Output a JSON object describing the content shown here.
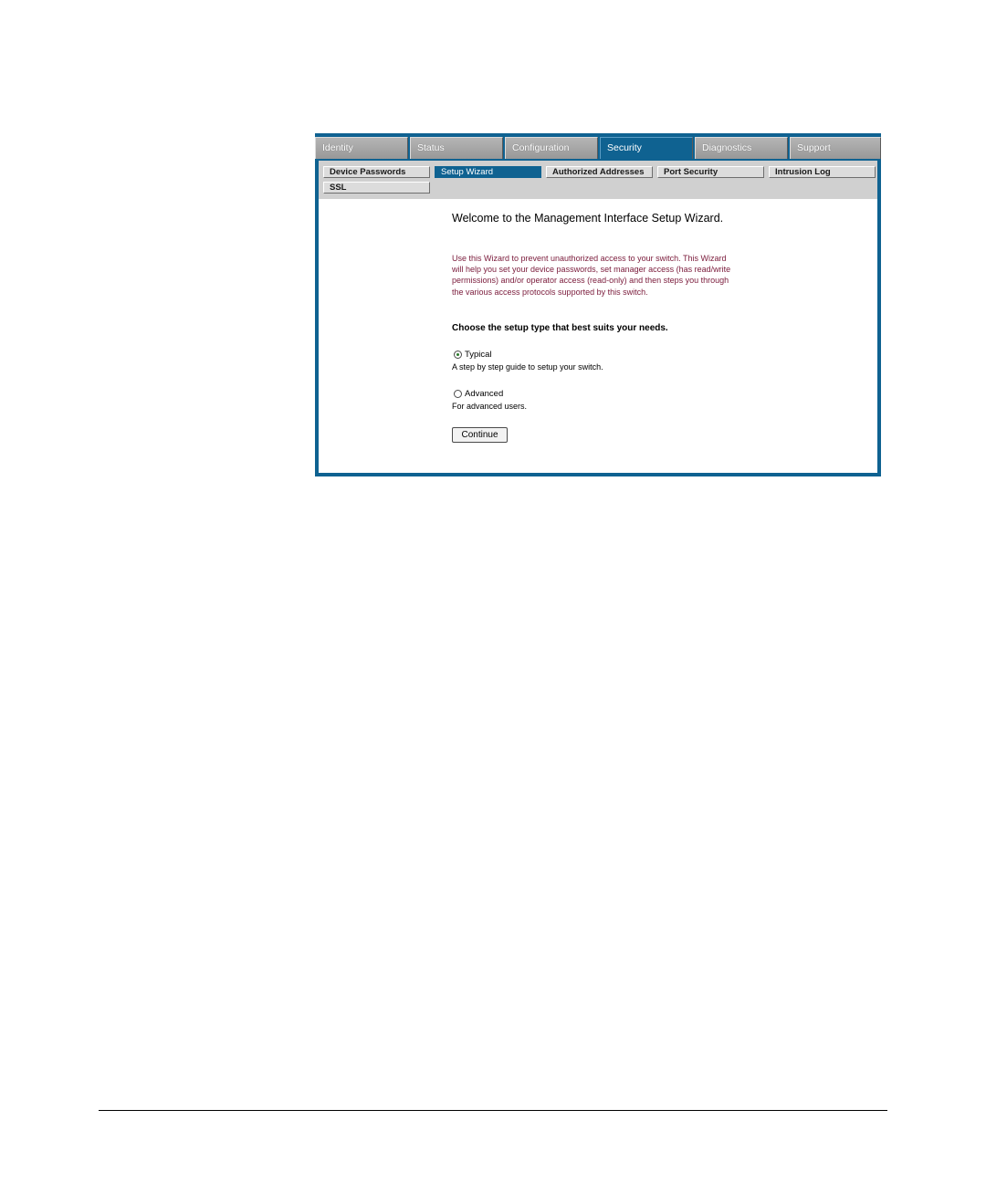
{
  "main_tabs": [
    {
      "label": "Identity",
      "active": false
    },
    {
      "label": "Status",
      "active": false
    },
    {
      "label": "Configuration",
      "active": false
    },
    {
      "label": "Security",
      "active": true
    },
    {
      "label": "Diagnostics",
      "active": false
    },
    {
      "label": "Support",
      "active": false
    }
  ],
  "sub_tabs": [
    {
      "label": "Device Passwords",
      "active": false
    },
    {
      "label": "Setup Wizard",
      "active": true
    },
    {
      "label": "Authorized Addresses",
      "active": false
    },
    {
      "label": "Port Security",
      "active": false
    },
    {
      "label": "Intrusion Log",
      "active": false
    },
    {
      "label": "SSL",
      "active": false
    }
  ],
  "wizard": {
    "title": "Welcome to the Management Interface Setup Wizard.",
    "intro": "Use this Wizard to prevent unauthorized access to your switch. This Wizard will help you set your device passwords, set manager access (has read/write permissions) and/or operator access (read-only) and then steps you through the various access protocols supported by this switch.",
    "choose_heading": "Choose the setup type that best suits your needs.",
    "options": [
      {
        "label": "Typical",
        "description": "A step by step guide to setup your switch.",
        "selected": true
      },
      {
        "label": "Advanced",
        "description": "For advanced users.",
        "selected": false
      }
    ],
    "continue_label": "Continue"
  },
  "colors": {
    "frame": "#0f6291",
    "intro_text": "#7a1a3a",
    "subnav_background": "#d0d0d0"
  }
}
